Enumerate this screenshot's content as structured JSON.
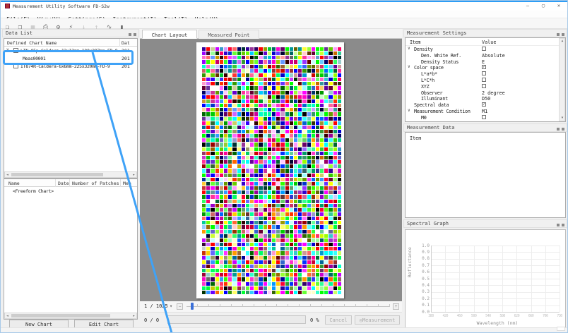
{
  "window": {
    "title": "Measurement Utility Software FD-S2w",
    "minimize": "–",
    "maximize": "▢",
    "close": "✕",
    "accent_color": "#2e9df5"
  },
  "menu": {
    "items": [
      {
        "id": "file",
        "label": "File(F)"
      },
      {
        "id": "view",
        "label": "View(V)"
      },
      {
        "id": "settings",
        "label": "Settings(S)"
      },
      {
        "id": "instrument",
        "label": "Instrument(I)"
      },
      {
        "id": "tool",
        "label": "Tool(T)"
      },
      {
        "id": "help",
        "label": "Help(H)"
      }
    ]
  },
  "toolbar": {
    "icons": [
      {
        "name": "new-chart-icon",
        "glyph": "❏",
        "enabled": true
      },
      {
        "name": "open-icon",
        "glyph": "❒",
        "enabled": true
      },
      {
        "name": "save-icon",
        "glyph": "▦",
        "enabled": false
      },
      {
        "name": "print-icon",
        "glyph": "⎙",
        "enabled": true
      },
      {
        "name": "settings-gear-icon",
        "glyph": "⚙",
        "enabled": true
      },
      {
        "name": "instrument-connect-icon",
        "glyph": "⚡",
        "enabled": true
      },
      {
        "name": "import-icon",
        "glyph": "↓",
        "enabled": false
      },
      {
        "name": "export-icon",
        "glyph": "↑",
        "enabled": false
      },
      {
        "name": "spectral-graph-icon",
        "glyph": "∿",
        "enabled": true
      },
      {
        "name": "stop-icon",
        "glyph": "▮",
        "enabled": true
      }
    ]
  },
  "scroll_icons": {
    "left": "◄",
    "right": "►",
    "up": "▲",
    "down": "▼"
  },
  "data_list": {
    "title": "Data List",
    "tree_columns": {
      "name": "Defined Chart Name",
      "date": "Dat"
    },
    "tree": [
      {
        "type": "chart",
        "expanded": true,
        "arrow": "∨",
        "checked": false,
        "label": "LIN-05p-Caldera-12x12mm-100x297mm-FD-9",
        "date": "201"
      },
      {
        "type": "measurement",
        "label": "Meas00001",
        "date": "201"
      },
      {
        "type": "chart",
        "checked": false,
        "label": "IT874R-Caldera-6x6mm-225x320mm-FD-9",
        "date": "201",
        "annotated": true
      }
    ],
    "lower_columns": [
      "Name",
      "Date",
      "Number of Patches",
      "Mea"
    ],
    "lower_rows": [
      "<Freeform Chart>"
    ],
    "new_chart_label": "New Chart",
    "edit_chart_label": "Edit Chart"
  },
  "chart_view": {
    "tabs": [
      {
        "id": "chart-layout",
        "label": "Chart Layout",
        "active": true
      },
      {
        "id": "measured-point",
        "label": "Measured Point",
        "active": false
      }
    ],
    "patch_nav": {
      "label": "1 / 1025",
      "dropdown": "▾",
      "zoom_out": "−",
      "zoom_in": "+"
    },
    "progress": {
      "counter": "0 / 0",
      "percent": "0 %",
      "cancel_label": "Cancel",
      "measure_icon": "◎",
      "measure_label": "Measurement"
    },
    "patch_grid": {
      "cols": 32,
      "rows": 57,
      "seed": 12,
      "levels": [
        0,
        0,
        51,
        102,
        153,
        204,
        255,
        255
      ]
    }
  },
  "measurement_settings": {
    "title": "Measurement Settings",
    "columns": {
      "item": "Item",
      "value": "Value"
    },
    "rows": [
      {
        "indent": 0,
        "arrow": "∨",
        "label": "Density",
        "check": false
      },
      {
        "indent": 1,
        "label": "Den. White Ref.",
        "value": "Absolute"
      },
      {
        "indent": 1,
        "label": "Density Status",
        "value": "E"
      },
      {
        "indent": 0,
        "arrow": "∨",
        "label": "Color space",
        "check": true
      },
      {
        "indent": 1,
        "label": "L*a*b*",
        "check": false
      },
      {
        "indent": 1,
        "label": "L*C*h",
        "check": false
      },
      {
        "indent": 1,
        "label": "XYZ",
        "check": false
      },
      {
        "indent": 1,
        "label": "Observer",
        "value": "2 degree"
      },
      {
        "indent": 1,
        "label": "Illuminant",
        "value": "D50"
      },
      {
        "indent": 0,
        "label": "Spectral data",
        "check": true
      },
      {
        "indent": 0,
        "arrow": "∨",
        "label": "Measurement Condition",
        "value": "M1"
      },
      {
        "indent": 1,
        "label": "M0",
        "check": false
      },
      {
        "indent": 1,
        "label": "M1",
        "check": true
      }
    ]
  },
  "measurement_data": {
    "title": "Measurement Data",
    "columns": {
      "item": "Item"
    }
  },
  "spectral_graph": {
    "title": "Spectral Graph",
    "ylabel": "Reflectance",
    "xlabel": "Wavelength (nm)",
    "yticks": [
      "1.0",
      "0.9",
      "0.8",
      "0.7",
      "0.6",
      "0.5",
      "0.4",
      "0.3",
      "0.2",
      "0.1",
      "0.0"
    ],
    "xticks": [
      "380",
      "420",
      "460",
      "500",
      "540",
      "580",
      "620",
      "660",
      "700",
      "730"
    ]
  },
  "annotation": {
    "color": "#3fa2f7"
  }
}
